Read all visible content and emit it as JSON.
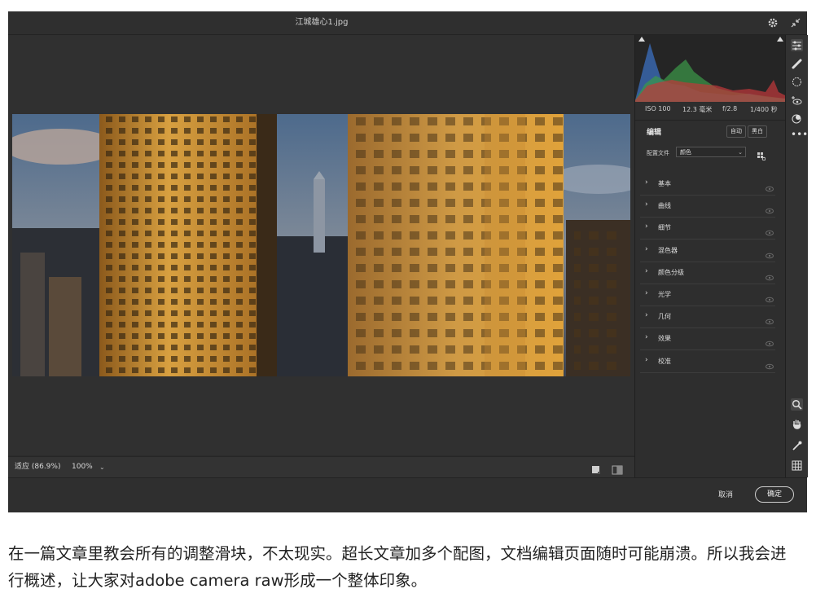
{
  "window": {
    "title": "江城雄心1.jpg",
    "settings_icon": "gear-icon",
    "collapse_icon": "shrink-icon"
  },
  "exif": {
    "iso": "ISO 100",
    "focal": "12.3 毫米",
    "aperture": "f/2.8",
    "shutter": "1/400 秒"
  },
  "edit": {
    "title": "编辑",
    "auto_label": "自动",
    "bw_label": "黑白",
    "profile_label": "配置文件",
    "profile_value": "颜色",
    "sections": [
      {
        "label": "基本"
      },
      {
        "label": "曲线"
      },
      {
        "label": "细节"
      },
      {
        "label": "混色器"
      },
      {
        "label": "颜色分级"
      },
      {
        "label": "光学"
      },
      {
        "label": "几何"
      },
      {
        "label": "效果"
      },
      {
        "label": "校准"
      }
    ]
  },
  "zoom": {
    "fit_label": "适应 (86.9%)",
    "percent_label": "100%"
  },
  "footer": {
    "cancel_label": "取消",
    "ok_label": "确定"
  },
  "tools": [
    "sliders-icon",
    "healing-brush-icon",
    "mask-icon",
    "red-eye-icon",
    "presets-icon",
    "more-icon",
    "zoom-icon",
    "hand-icon",
    "color-sampler-icon",
    "grid-icon"
  ],
  "caption": {
    "text": "在一篇文章里教会所有的调整滑块，不太现实。超长文章加多个配图，文档编辑页面随时可能崩溃。所以我会进行概述，让大家对adobe camera raw形成一个整体印象。"
  }
}
